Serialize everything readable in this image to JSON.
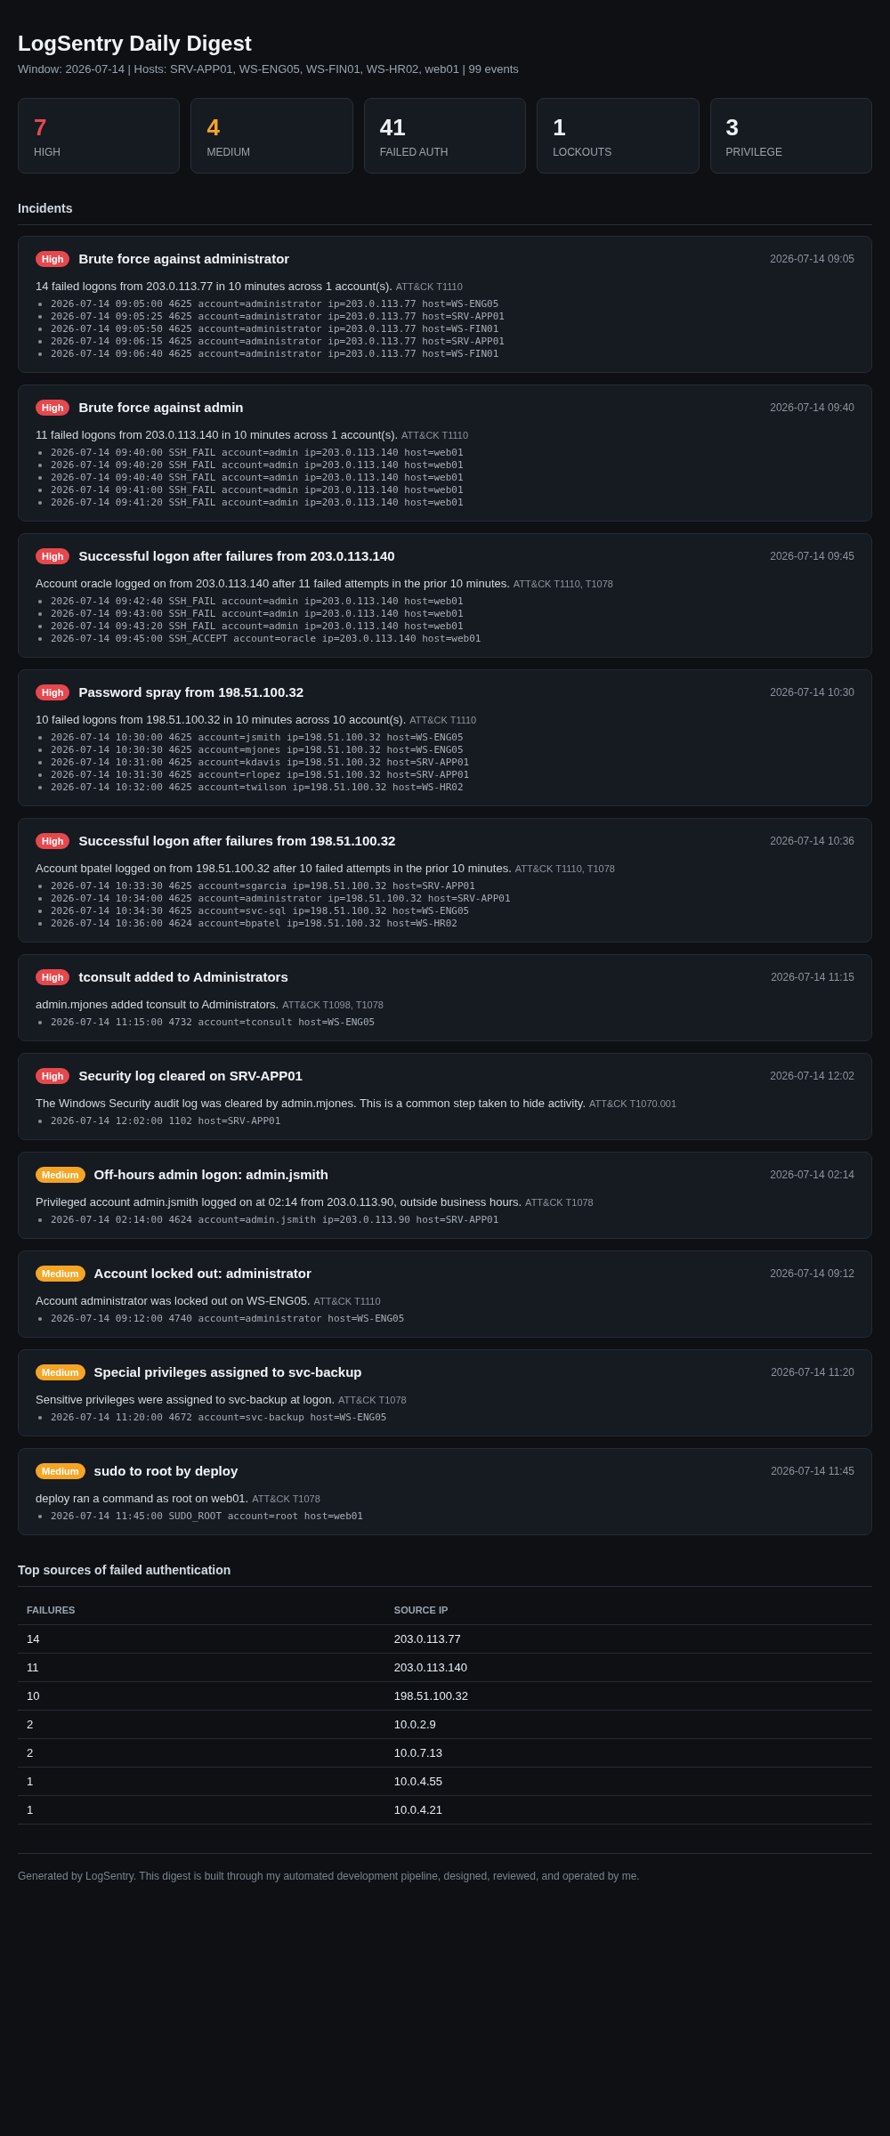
{
  "header": {
    "title": "LogSentry Daily Digest",
    "subtitle": "Window: 2026-07-14 | Hosts: SRV-APP01, WS-ENG05, WS-FIN01, WS-HR02, web01 | 99 events"
  },
  "stats": [
    {
      "value": "7",
      "label": "HIGH",
      "color": "#e5484d"
    },
    {
      "value": "4",
      "label": "MEDIUM",
      "color": "#f5a524"
    },
    {
      "value": "41",
      "label": "FAILED AUTH",
      "color": "#eef1f4"
    },
    {
      "value": "1",
      "label": "LOCKOUTS",
      "color": "#eef1f4"
    },
    {
      "value": "3",
      "label": "PRIVILEGE",
      "color": "#eef1f4"
    }
  ],
  "incidents": {
    "heading": "Incidents",
    "items": [
      {
        "severity": "High",
        "color": "#e5484d",
        "title": "Brute force against administrator",
        "time": "2026-07-14 09:05",
        "summary": "14 failed logons from 203.0.113.77 in 10 minutes across 1 account(s).",
        "attack": "ATT&CK T1110",
        "events": [
          "2026-07-14 09:05:00 4625 account=administrator ip=203.0.113.77 host=WS-ENG05",
          "2026-07-14 09:05:25 4625 account=administrator ip=203.0.113.77 host=SRV-APP01",
          "2026-07-14 09:05:50 4625 account=administrator ip=203.0.113.77 host=WS-FIN01",
          "2026-07-14 09:06:15 4625 account=administrator ip=203.0.113.77 host=SRV-APP01",
          "2026-07-14 09:06:40 4625 account=administrator ip=203.0.113.77 host=WS-FIN01"
        ]
      },
      {
        "severity": "High",
        "color": "#e5484d",
        "title": "Brute force against admin",
        "time": "2026-07-14 09:40",
        "summary": "11 failed logons from 203.0.113.140 in 10 minutes across 1 account(s).",
        "attack": "ATT&CK T1110",
        "events": [
          "2026-07-14 09:40:00 SSH_FAIL account=admin ip=203.0.113.140 host=web01",
          "2026-07-14 09:40:20 SSH_FAIL account=admin ip=203.0.113.140 host=web01",
          "2026-07-14 09:40:40 SSH_FAIL account=admin ip=203.0.113.140 host=web01",
          "2026-07-14 09:41:00 SSH_FAIL account=admin ip=203.0.113.140 host=web01",
          "2026-07-14 09:41:20 SSH_FAIL account=admin ip=203.0.113.140 host=web01"
        ]
      },
      {
        "severity": "High",
        "color": "#e5484d",
        "title": "Successful logon after failures from 203.0.113.140",
        "time": "2026-07-14 09:45",
        "summary": "Account oracle logged on from 203.0.113.140 after 11 failed attempts in the prior 10 minutes.",
        "attack": "ATT&CK T1110, T1078",
        "events": [
          "2026-07-14 09:42:40 SSH_FAIL account=admin ip=203.0.113.140 host=web01",
          "2026-07-14 09:43:00 SSH_FAIL account=admin ip=203.0.113.140 host=web01",
          "2026-07-14 09:43:20 SSH_FAIL account=admin ip=203.0.113.140 host=web01",
          "2026-07-14 09:45:00 SSH_ACCEPT account=oracle ip=203.0.113.140 host=web01"
        ]
      },
      {
        "severity": "High",
        "color": "#e5484d",
        "title": "Password spray from 198.51.100.32",
        "time": "2026-07-14 10:30",
        "summary": "10 failed logons from 198.51.100.32 in 10 minutes across 10 account(s).",
        "attack": "ATT&CK T1110",
        "events": [
          "2026-07-14 10:30:00 4625 account=jsmith ip=198.51.100.32 host=WS-ENG05",
          "2026-07-14 10:30:30 4625 account=mjones ip=198.51.100.32 host=WS-ENG05",
          "2026-07-14 10:31:00 4625 account=kdavis ip=198.51.100.32 host=SRV-APP01",
          "2026-07-14 10:31:30 4625 account=rlopez ip=198.51.100.32 host=SRV-APP01",
          "2026-07-14 10:32:00 4625 account=twilson ip=198.51.100.32 host=WS-HR02"
        ]
      },
      {
        "severity": "High",
        "color": "#e5484d",
        "title": "Successful logon after failures from 198.51.100.32",
        "time": "2026-07-14 10:36",
        "summary": "Account bpatel logged on from 198.51.100.32 after 10 failed attempts in the prior 10 minutes.",
        "attack": "ATT&CK T1110, T1078",
        "events": [
          "2026-07-14 10:33:30 4625 account=sgarcia ip=198.51.100.32 host=SRV-APP01",
          "2026-07-14 10:34:00 4625 account=administrator ip=198.51.100.32 host=SRV-APP01",
          "2026-07-14 10:34:30 4625 account=svc-sql ip=198.51.100.32 host=WS-ENG05",
          "2026-07-14 10:36:00 4624 account=bpatel ip=198.51.100.32 host=WS-HR02"
        ]
      },
      {
        "severity": "High",
        "color": "#e5484d",
        "title": "tconsult added to Administrators",
        "time": "2026-07-14 11:15",
        "summary": "admin.mjones added tconsult to Administrators.",
        "attack": "ATT&CK T1098, T1078",
        "events": [
          "2026-07-14 11:15:00 4732 account=tconsult host=WS-ENG05"
        ]
      },
      {
        "severity": "High",
        "color": "#e5484d",
        "title": "Security log cleared on SRV-APP01",
        "time": "2026-07-14 12:02",
        "summary": "The Windows Security audit log was cleared by admin.mjones. This is a common step taken to hide activity.",
        "attack": "ATT&CK T1070.001",
        "events": [
          "2026-07-14 12:02:00 1102 host=SRV-APP01"
        ]
      },
      {
        "severity": "Medium",
        "color": "#f5a524",
        "title": "Off-hours admin logon: admin.jsmith",
        "time": "2026-07-14 02:14",
        "summary": "Privileged account admin.jsmith logged on at 02:14 from 203.0.113.90, outside business hours.",
        "attack": "ATT&CK T1078",
        "events": [
          "2026-07-14 02:14:00 4624 account=admin.jsmith ip=203.0.113.90 host=SRV-APP01"
        ]
      },
      {
        "severity": "Medium",
        "color": "#f5a524",
        "title": "Account locked out: administrator",
        "time": "2026-07-14 09:12",
        "summary": "Account administrator was locked out on WS-ENG05.",
        "attack": "ATT&CK T1110",
        "events": [
          "2026-07-14 09:12:00 4740 account=administrator host=WS-ENG05"
        ]
      },
      {
        "severity": "Medium",
        "color": "#f5a524",
        "title": "Special privileges assigned to svc-backup",
        "time": "2026-07-14 11:20",
        "summary": "Sensitive privileges were assigned to svc-backup at logon.",
        "attack": "ATT&CK T1078",
        "events": [
          "2026-07-14 11:20:00 4672 account=svc-backup host=WS-ENG05"
        ]
      },
      {
        "severity": "Medium",
        "color": "#f5a524",
        "title": "sudo to root by deploy",
        "time": "2026-07-14 11:45",
        "summary": "deploy ran a command as root on web01.",
        "attack": "ATT&CK T1078",
        "events": [
          "2026-07-14 11:45:00 SUDO_ROOT account=root host=web01"
        ]
      }
    ]
  },
  "failed_auth": {
    "heading": "Top sources of failed authentication",
    "columns": [
      "FAILURES",
      "SOURCE IP"
    ],
    "rows": [
      [
        "14",
        "203.0.113.77"
      ],
      [
        "11",
        "203.0.113.140"
      ],
      [
        "10",
        "198.51.100.32"
      ],
      [
        "2",
        "10.0.2.9"
      ],
      [
        "2",
        "10.0.7.13"
      ],
      [
        "1",
        "10.0.4.55"
      ],
      [
        "1",
        "10.0.4.21"
      ]
    ]
  },
  "footer": "Generated by LogSentry. This digest is built through my automated development pipeline, designed, reviewed, and operated by me."
}
